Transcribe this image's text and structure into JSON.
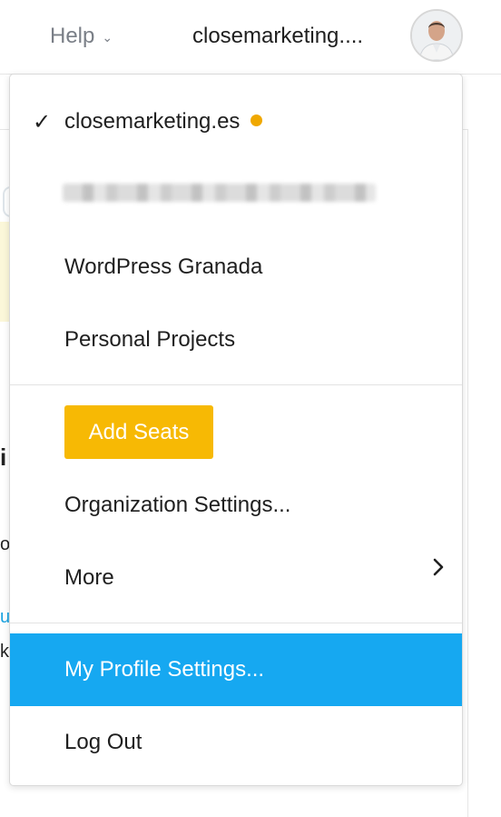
{
  "header": {
    "help_label": "Help",
    "org_name": "closemarketing....",
    "avatar_icon": "user-avatar"
  },
  "menu": {
    "current_org": "closemarketing.es",
    "orgs": [
      "WordPress Granada",
      "Personal Projects"
    ],
    "add_seats_label": "Add Seats",
    "org_settings_label": "Organization Settings...",
    "more_label": "More",
    "profile_settings_label": "My Profile Settings...",
    "logout_label": "Log Out"
  },
  "background": {
    "frag1": "i",
    "frag2": "o",
    "frag3": "u",
    "frag4": "k"
  },
  "colors": {
    "accent_blue": "#16a8f1",
    "add_seats_yellow": "#f7b904",
    "status_dot": "#f0a800"
  },
  "icons": {
    "check": "checkmark-icon",
    "chevron_down": "chevron-down-icon",
    "chevron_right": "chevron-right-icon",
    "status_dot": "status-dot-icon"
  }
}
